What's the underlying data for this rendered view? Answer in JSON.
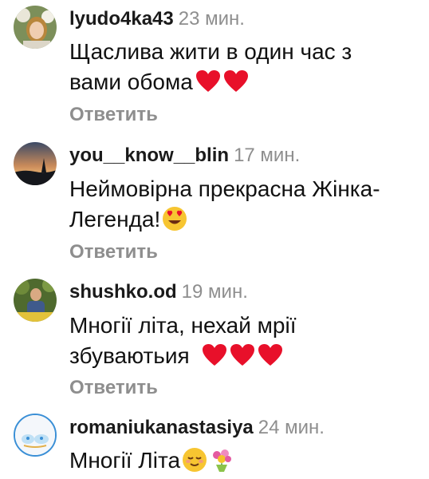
{
  "comments": [
    {
      "username": "lyudo4ka43",
      "time": "23 мин.",
      "line1": "Щаслива жити в один час з",
      "line2": "вами обома",
      "reply": "Ответить",
      "avatar_icon": "woman-with-flowers-avatar",
      "emojis": [
        "red-heart-icon",
        "red-heart-icon"
      ]
    },
    {
      "username": "you__know__blin",
      "time": "17 мин.",
      "line1": "Неймовірна прекрасна Жінка-",
      "line2": "Легенда!",
      "reply": "Ответить",
      "avatar_icon": "sunset-landscape-avatar",
      "emojis": [
        "heart-eyes-face-icon"
      ]
    },
    {
      "username": "shushko.od",
      "time": "19 мин.",
      "line1": "Многії літа, нехай мрії",
      "line2": "збуваютьия",
      "reply": "Ответить",
      "avatar_icon": "person-outdoors-avatar",
      "emojis": [
        "red-heart-icon",
        "red-heart-icon",
        "red-heart-icon"
      ]
    },
    {
      "username": "romaniukanastasiya",
      "time": "24 мин.",
      "line1": "Многії Літа",
      "avatar_icon": "blue-logo-avatar",
      "emojis": [
        "relieved-face-icon",
        "bouquet-icon"
      ]
    }
  ],
  "colors": {
    "heart": "#e8102a",
    "secondary_text": "#8e8e8e",
    "primary_text": "#111111"
  }
}
